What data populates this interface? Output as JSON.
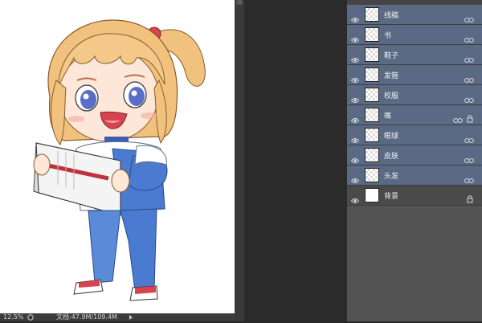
{
  "layers": [
    {
      "name": "线稿",
      "selected": true,
      "linked": true,
      "locked": false
    },
    {
      "name": "书",
      "selected": true,
      "linked": true,
      "locked": false
    },
    {
      "name": "鞋子",
      "selected": true,
      "linked": true,
      "locked": false
    },
    {
      "name": "发箍",
      "selected": true,
      "linked": true,
      "locked": false
    },
    {
      "name": "校服",
      "selected": true,
      "linked": true,
      "locked": false
    },
    {
      "name": "嘴",
      "selected": true,
      "linked": true,
      "locked": true
    },
    {
      "name": "眼球",
      "selected": true,
      "linked": true,
      "locked": false
    },
    {
      "name": "皮肤",
      "selected": true,
      "linked": true,
      "locked": false
    },
    {
      "name": "头发",
      "selected": true,
      "linked": true,
      "locked": false
    },
    {
      "name": "背景",
      "selected": false,
      "linked": false,
      "locked": true
    }
  ],
  "statusbar": {
    "zoom": "12.5%",
    "doc_info": "文档:47.9M/109.4M"
  },
  "colors": {
    "canvas_bg": "#ffffff",
    "workspace": "#282828",
    "panel_bg": "#535353",
    "selected_layer": "#5a6a85",
    "hair": "#f1c27d",
    "jacket_blue": "#4a7bd1",
    "shoe_red": "#d9434f"
  }
}
